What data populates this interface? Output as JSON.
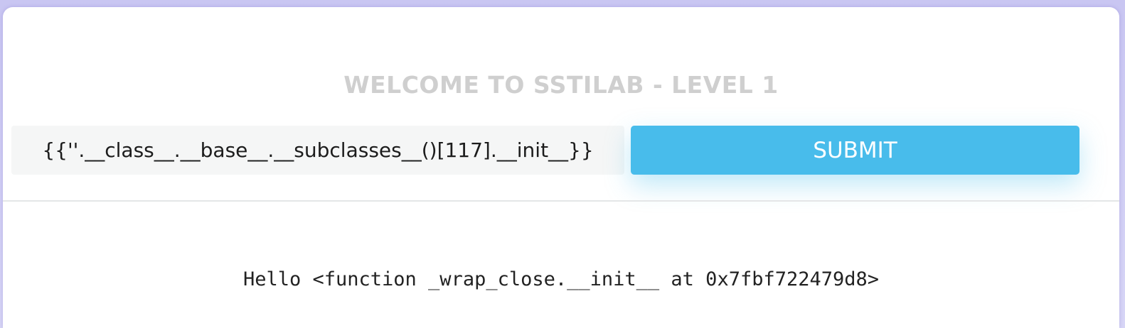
{
  "header": {
    "title": "WELCOME TO SSTILAB - LEVEL 1"
  },
  "form": {
    "input_value": "{{''.__class__.__base__.__subclasses__()[117].__init__}}",
    "submit_label": "SUBMIT"
  },
  "output": {
    "text": "Hello <function _wrap_close.__init__ at 0x7fbf722479d8>"
  },
  "colors": {
    "accent": "#48bceb",
    "title": "#cfcfcf",
    "input_bg": "#f5f6f6",
    "page_bg": "#c9c6f2"
  }
}
